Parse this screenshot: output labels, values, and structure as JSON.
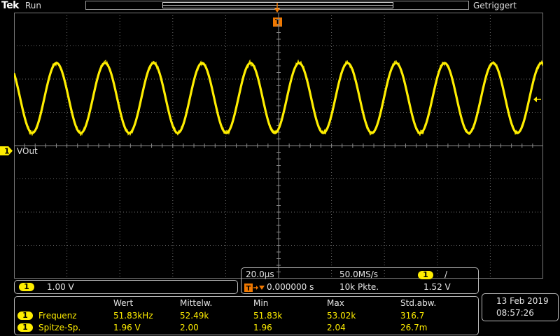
{
  "header": {
    "brand": "Tek",
    "acq_state": "Run",
    "trigger_status": "Getriggert"
  },
  "trigger": {
    "marker_label": "T",
    "position_readout": "0.000000 s",
    "level": "1.52 V",
    "slope_symbol": "/",
    "source_channel": "1"
  },
  "channel1": {
    "number": "1",
    "label": "VOut",
    "scale": "1.00 V",
    "color": "#ffee00"
  },
  "horizontal": {
    "scale": "20.0µs",
    "sample_rate": "50.0MS/s",
    "record_length": "10k Pkte."
  },
  "measurements": {
    "headers": [
      "Wert",
      "Mittelw.",
      "Min",
      "Max",
      "Std.abw."
    ],
    "rows": [
      {
        "channel": "1",
        "name": "Frequenz",
        "values": [
          "51.83kHz",
          "52.49k",
          "51.83k",
          "53.02k",
          "316.7"
        ]
      },
      {
        "channel": "1",
        "name": "Spitze-Sp.",
        "values": [
          "1.96 V",
          "2.00",
          "1.96",
          "2.04",
          "26.7m"
        ]
      }
    ]
  },
  "datetime": {
    "date": "13 Feb  2019",
    "time": "08:57:26"
  },
  "colors": {
    "trace": "#ffee00",
    "trigger_accent": "#f07800",
    "graticule": "#7a7a7a",
    "panel_border": "#bcbcbc"
  },
  "waveform": {
    "type": "sine",
    "frequency": "51.83kHz",
    "peak_to_peak": "1.96 V"
  }
}
